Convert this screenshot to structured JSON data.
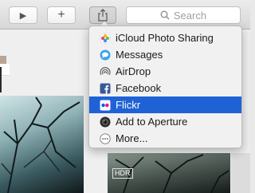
{
  "toolbar": {
    "play_glyph": "▶",
    "add_glyph": "+",
    "share_icon": "share-icon",
    "search_placeholder": "Search"
  },
  "share_menu": {
    "items": [
      {
        "label": "iCloud Photo Sharing",
        "icon": "icloud-photo-sharing-icon",
        "selected": false
      },
      {
        "label": "Messages",
        "icon": "messages-icon",
        "selected": false
      },
      {
        "label": "AirDrop",
        "icon": "airdrop-icon",
        "selected": false
      },
      {
        "label": "Facebook",
        "icon": "facebook-icon",
        "selected": false
      },
      {
        "label": "Flickr",
        "icon": "flickr-icon",
        "selected": true
      },
      {
        "label": "Add to Aperture",
        "icon": "aperture-icon",
        "selected": false
      },
      {
        "label": "More...",
        "icon": "more-icon",
        "selected": false
      }
    ]
  },
  "thumbnails": {
    "hdr_badge": "HDR"
  },
  "colors": {
    "selection": "#1f62d6",
    "menu_bg": "#f1f1f1",
    "toolbar_bg": "#dcdcdc"
  }
}
